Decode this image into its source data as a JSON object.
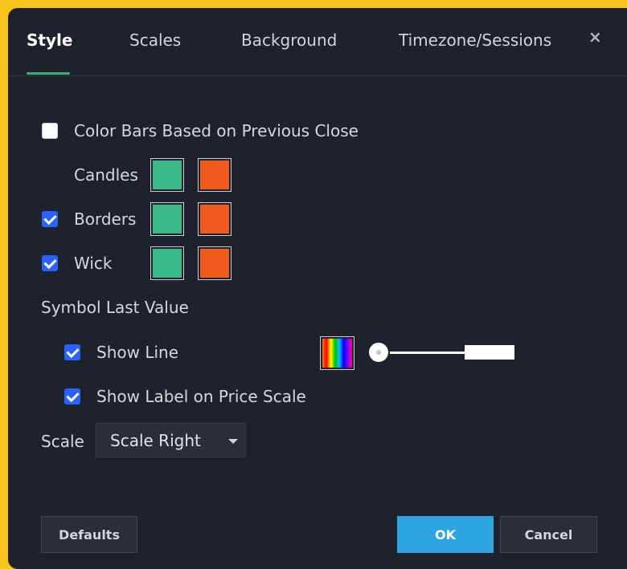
{
  "tabs": [
    {
      "label": "Style",
      "active": true
    },
    {
      "label": "Scales",
      "active": false
    },
    {
      "label": "Background",
      "active": false
    },
    {
      "label": "Timezone/Sessions",
      "active": false
    }
  ],
  "close_icon": "×",
  "options": {
    "color_bars": {
      "label": "Color Bars Based on Previous Close",
      "checked": false
    },
    "candles": {
      "label": "Candles",
      "up_color": "#3bb98a",
      "down_color": "#f05a1c"
    },
    "borders": {
      "label": "Borders",
      "checked": true,
      "up_color": "#3bb98a",
      "down_color": "#f05a1c"
    },
    "wick": {
      "label": "Wick",
      "checked": true,
      "up_color": "#3bb98a",
      "down_color": "#f05a1c"
    }
  },
  "symbol_last_value": {
    "heading": "Symbol Last Value",
    "show_line": {
      "label": "Show Line",
      "checked": true
    },
    "show_label": {
      "label": "Show Label on Price Scale",
      "checked": true
    }
  },
  "scale": {
    "label": "Scale",
    "selected": "Scale Right"
  },
  "buttons": {
    "defaults": "Defaults",
    "ok": "OK",
    "cancel": "Cancel"
  },
  "colors": {
    "accent": "#2ea5e0",
    "active_tab_underline": "#3bb273",
    "checkbox": "#2962ff",
    "background": "#1e222d",
    "frame": "#f7c31c"
  }
}
